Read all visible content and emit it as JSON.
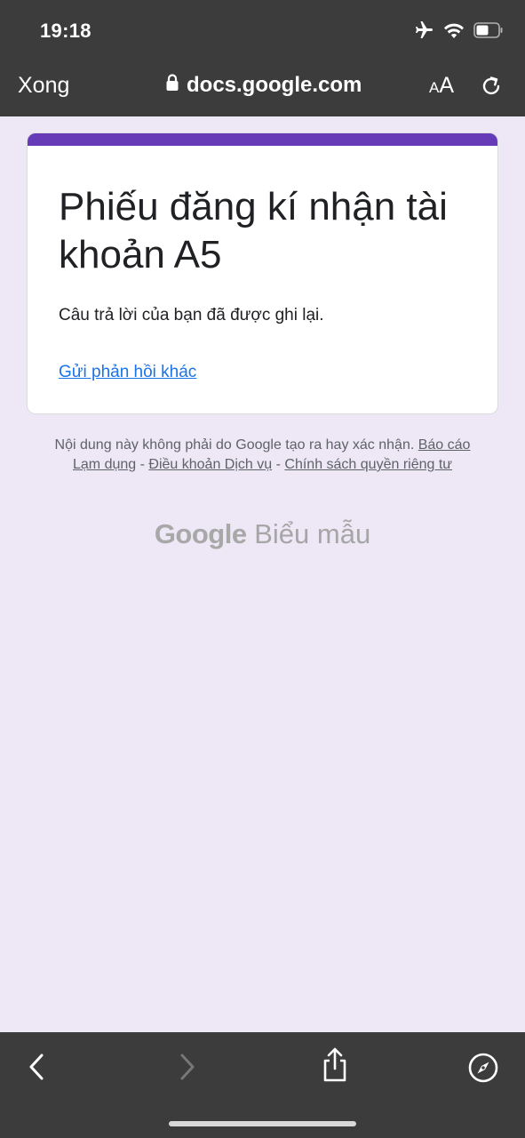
{
  "status_bar": {
    "time": "19:18",
    "icons": [
      "airplane-icon",
      "wifi-icon",
      "battery-icon"
    ]
  },
  "browser": {
    "done_label": "Xong",
    "url": "docs.google.com",
    "reader_label_small": "A",
    "reader_label_large": "A"
  },
  "form": {
    "title": "Phiếu đăng kí nhận tài khoản A5",
    "confirmation": "Câu trả lời của bạn đã được ghi lại.",
    "resubmit_link": "Gửi phản hồi khác",
    "accent_color": "#673ab7"
  },
  "footer": {
    "disclaimer_text": "Nội dung này không phải do Google tạo ra hay xác nhận.",
    "report_link": "Báo cáo Lạm dụng",
    "separator": "-",
    "terms_link": "Điều khoản Dịch vụ",
    "privacy_link": "Chính sách quyền riêng tư",
    "brand_google": "Google",
    "brand_forms": "Biểu mẫu"
  },
  "toolbar": {
    "icons": [
      "back-icon",
      "forward-icon",
      "share-icon",
      "compass-icon"
    ]
  }
}
